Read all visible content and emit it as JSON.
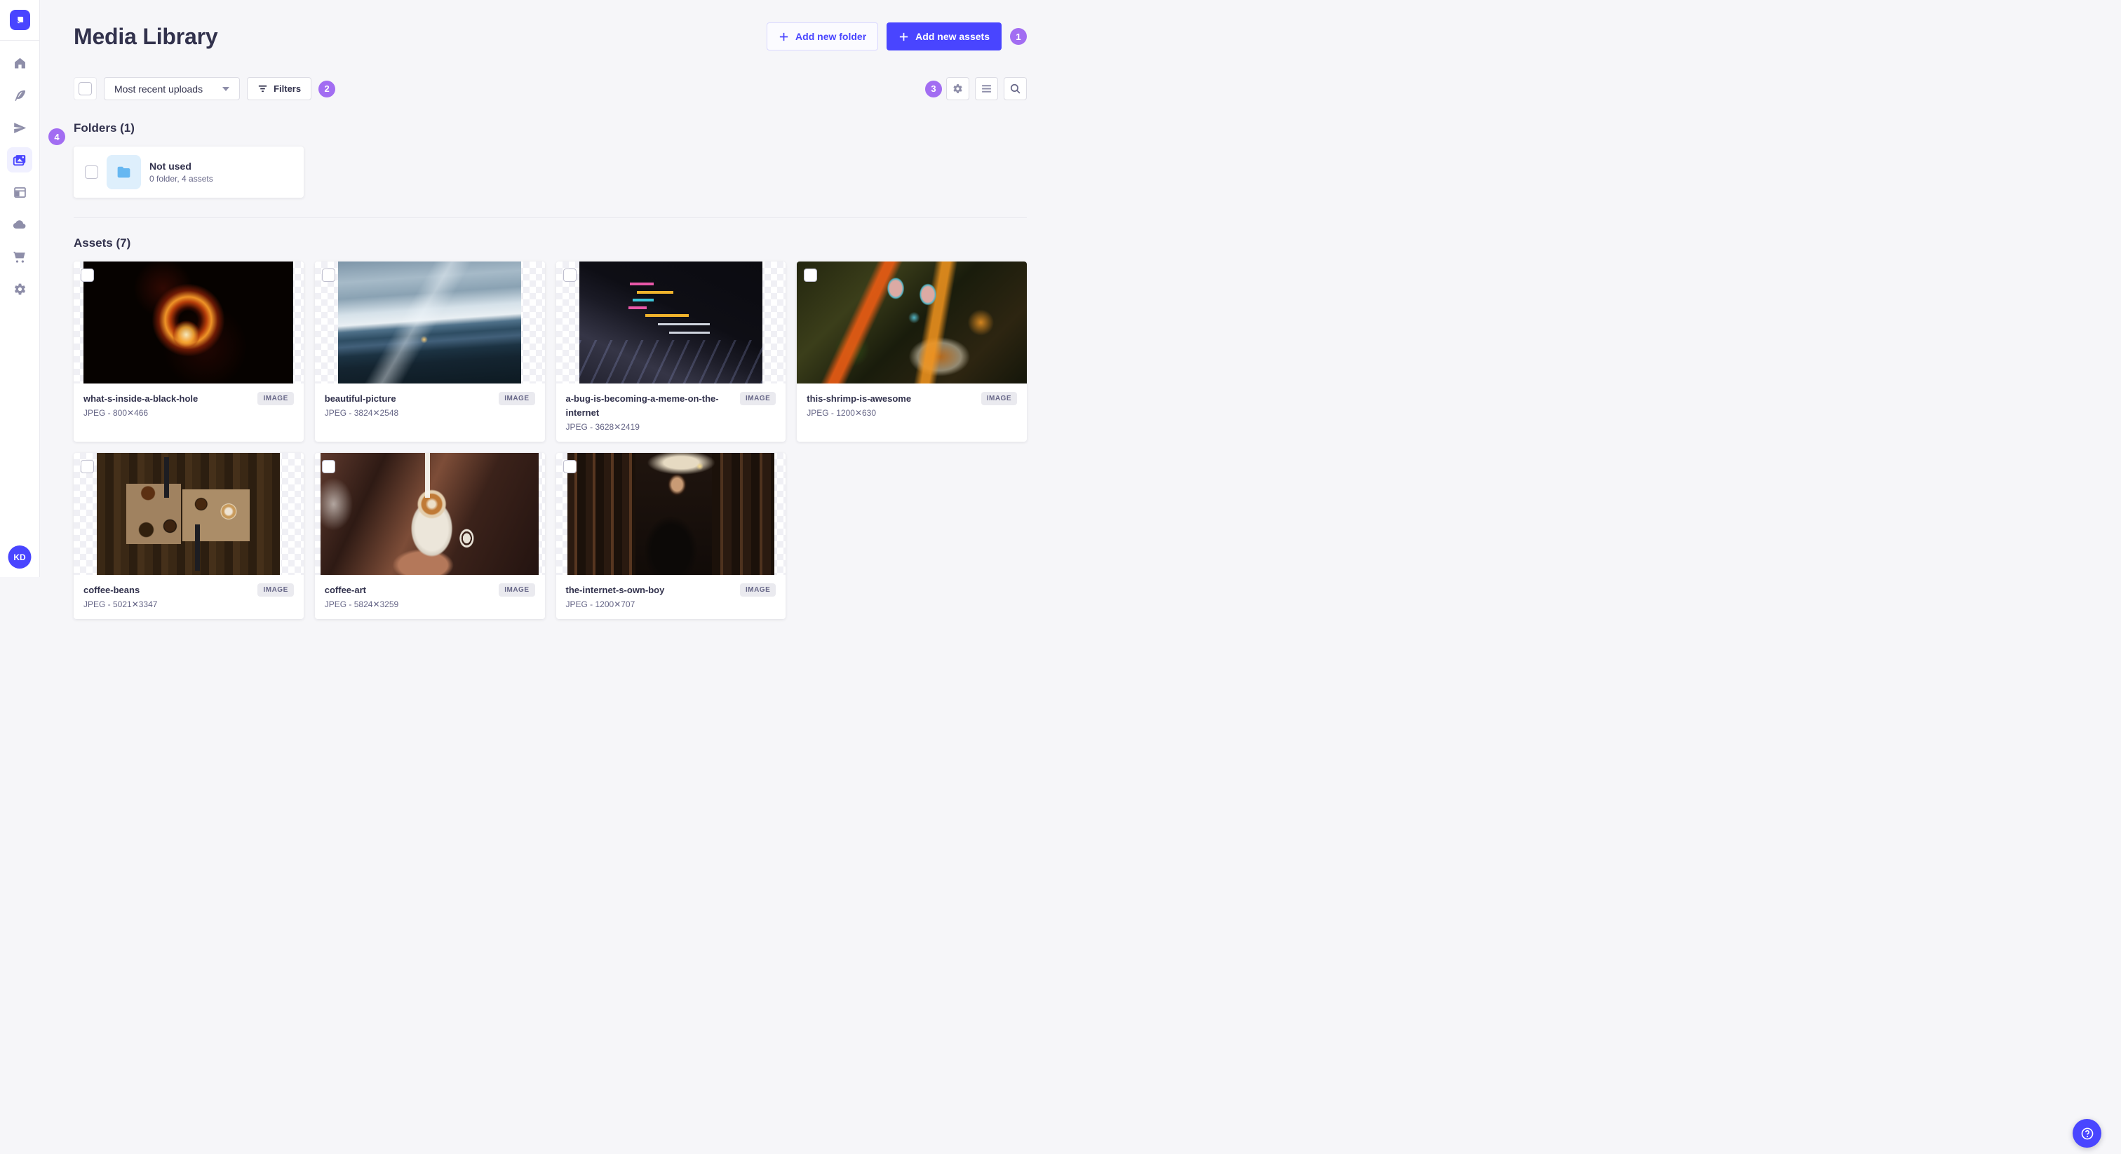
{
  "colors": {
    "primary": "#4945ff",
    "primary_light_bg": "#f0f0ff",
    "annotation_badge": "#a26df2",
    "folder_icon_blue": "#66b7f1",
    "page_bg": "#f6f6f9",
    "text_primary": "#32324d",
    "text_secondary": "#666687"
  },
  "sidebar": {
    "logo_icon": "strapi-logo",
    "items": [
      {
        "icon": "home-icon",
        "active": false
      },
      {
        "icon": "feather-icon",
        "active": false
      },
      {
        "icon": "paper-plane-icon",
        "active": false
      },
      {
        "icon": "media-library-icon",
        "active": true
      },
      {
        "icon": "layout-icon",
        "active": false
      },
      {
        "icon": "cloud-icon",
        "active": false
      },
      {
        "icon": "cart-icon",
        "active": false
      },
      {
        "icon": "gear-icon",
        "active": false
      }
    ],
    "avatar_initials": "KD"
  },
  "header": {
    "title": "Media Library",
    "add_folder_label": "Add new folder",
    "add_assets_label": "Add new assets"
  },
  "toolbar": {
    "sort_value": "Most recent uploads",
    "filters_label": "Filters",
    "right_icons": [
      "gear-icon",
      "list-icon",
      "search-icon"
    ]
  },
  "annotations": {
    "one": "1",
    "two": "2",
    "three": "3",
    "four": "4"
  },
  "folders_section": {
    "heading": "Folders (1)",
    "folders": [
      {
        "name": "Not used",
        "meta": "0 folder, 4 assets"
      }
    ]
  },
  "assets_section": {
    "heading": "Assets (7)",
    "assets": [
      {
        "name": "what-s-inside-a-black-hole",
        "meta": "JPEG - 800✕466",
        "badge": "IMAGE",
        "thumb": "black-hole"
      },
      {
        "name": "beautiful-picture",
        "meta": "JPEG - 3824✕2548",
        "badge": "IMAGE",
        "thumb": "mountains"
      },
      {
        "name": "a-bug-is-becoming-a-meme-on-the-internet",
        "meta": "JPEG - 3628✕2419",
        "badge": "IMAGE",
        "thumb": "laptop-code"
      },
      {
        "name": "this-shrimp-is-awesome",
        "meta": "JPEG - 1200✕630",
        "badge": "IMAGE",
        "thumb": "shrimp"
      },
      {
        "name": "coffee-beans",
        "meta": "JPEG - 5021✕3347",
        "badge": "IMAGE",
        "thumb": "coffee-beans"
      },
      {
        "name": "coffee-art",
        "meta": "JPEG - 5824✕3259",
        "badge": "IMAGE",
        "thumb": "coffee-art"
      },
      {
        "name": "the-internet-s-own-boy",
        "meta": "JPEG - 1200✕707",
        "badge": "IMAGE",
        "thumb": "library-boy"
      }
    ]
  },
  "help": {
    "icon": "question-mark-icon"
  }
}
